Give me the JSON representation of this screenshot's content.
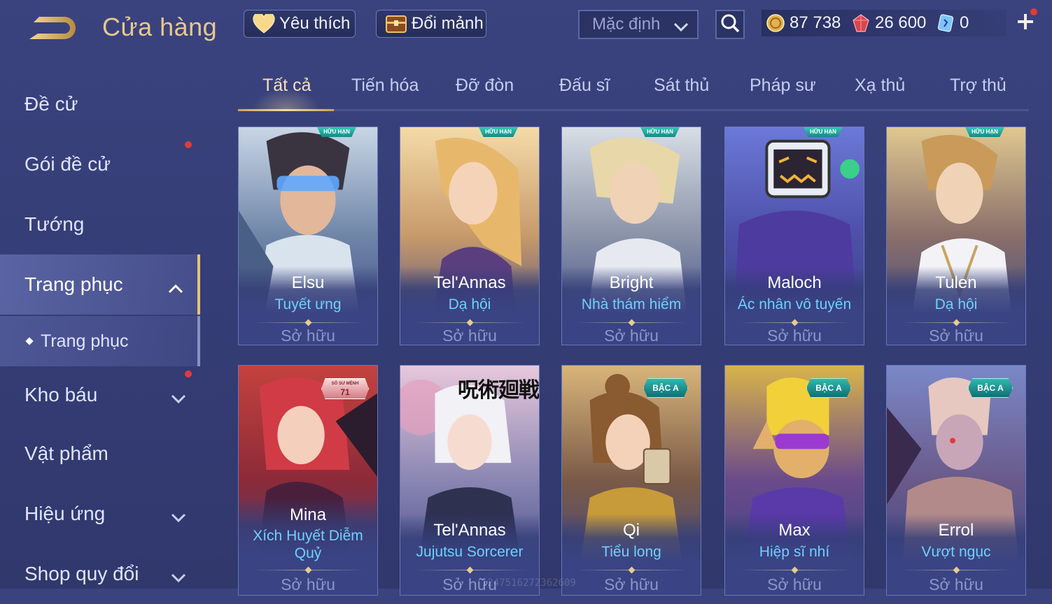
{
  "header": {
    "title": "Cửa hàng",
    "favorite_label": "Yêu thích",
    "fragment_label": "Đổi mảnh",
    "sort_value": "Mặc định",
    "currencies": [
      {
        "name": "gold",
        "value": "87 738",
        "icon": "gold-coin-icon"
      },
      {
        "name": "gem",
        "value": "26 600",
        "icon": "red-gem-icon"
      },
      {
        "name": "ticket",
        "value": "0",
        "icon": "blue-ticket-icon"
      }
    ]
  },
  "sidebar": {
    "items": [
      {
        "label": "Đề cử",
        "has_dot": false
      },
      {
        "label": "Gói đề cử",
        "has_dot": true
      },
      {
        "label": "Tướng",
        "has_dot": false
      },
      {
        "label": "Trang phục",
        "expanded": true,
        "active": true
      },
      {
        "label": "Trang phục",
        "sub": true
      },
      {
        "label": "Kho báu",
        "has_dot": true
      },
      {
        "label": "Vật phẩm"
      },
      {
        "label": "Hiệu ứng"
      },
      {
        "label": "Shop quy đổi"
      }
    ]
  },
  "tabs": [
    "Tất cả",
    "Tiến hóa",
    "Đỡ đòn",
    "Đấu sĩ",
    "Sát thủ",
    "Pháp sư",
    "Xạ thủ",
    "Trợ thủ"
  ],
  "active_tab": 0,
  "cards": [
    {
      "hero": "Elsu",
      "skin": "Tuyết ưng",
      "status": "Sở hữu",
      "badge": "HỮU HẠN"
    },
    {
      "hero": "Tel'Annas",
      "skin": "Dạ hội",
      "status": "Sở hữu",
      "badge": "HỮU HẠN"
    },
    {
      "hero": "Bright",
      "skin": "Nhà thám hiểm",
      "status": "Sở hữu",
      "badge": "HỮU HẠN"
    },
    {
      "hero": "Maloch",
      "skin": "Ác nhân vô tuyến",
      "status": "Sở hữu",
      "badge": "HỮU HẠN"
    },
    {
      "hero": "Tulen",
      "skin": "Dạ hội",
      "status": "Sở hữu",
      "badge": "HỮU HẠN"
    },
    {
      "hero": "Mina",
      "skin": "Xích Huyết Diễm Quỷ",
      "status": "Sở hữu",
      "badge_serial_top": "SỐ SƯ MỆNH",
      "badge_serial": "71"
    },
    {
      "hero": "Tel'Annas",
      "skin": "Jujutsu Sorcerer",
      "status": "Sở hữu",
      "collab": "呪術廻戦"
    },
    {
      "hero": "Qi",
      "skin": "Tiểu long",
      "status": "Sở hữu",
      "badge": "BẬC A"
    },
    {
      "hero": "Max",
      "skin": "Hiệp sĩ nhí",
      "status": "Sở hữu",
      "badge": "BẬC A"
    },
    {
      "hero": "Errol",
      "skin": "Vượt ngục",
      "status": "Sở hữu",
      "badge": "BẬC A"
    }
  ],
  "watermark": "1247516272362609",
  "colors": {
    "accent_gold": "#e8c98a",
    "skin_blue": "#6fd0ff",
    "background": "#353d76",
    "badge_teal": "#2fb8ad"
  }
}
